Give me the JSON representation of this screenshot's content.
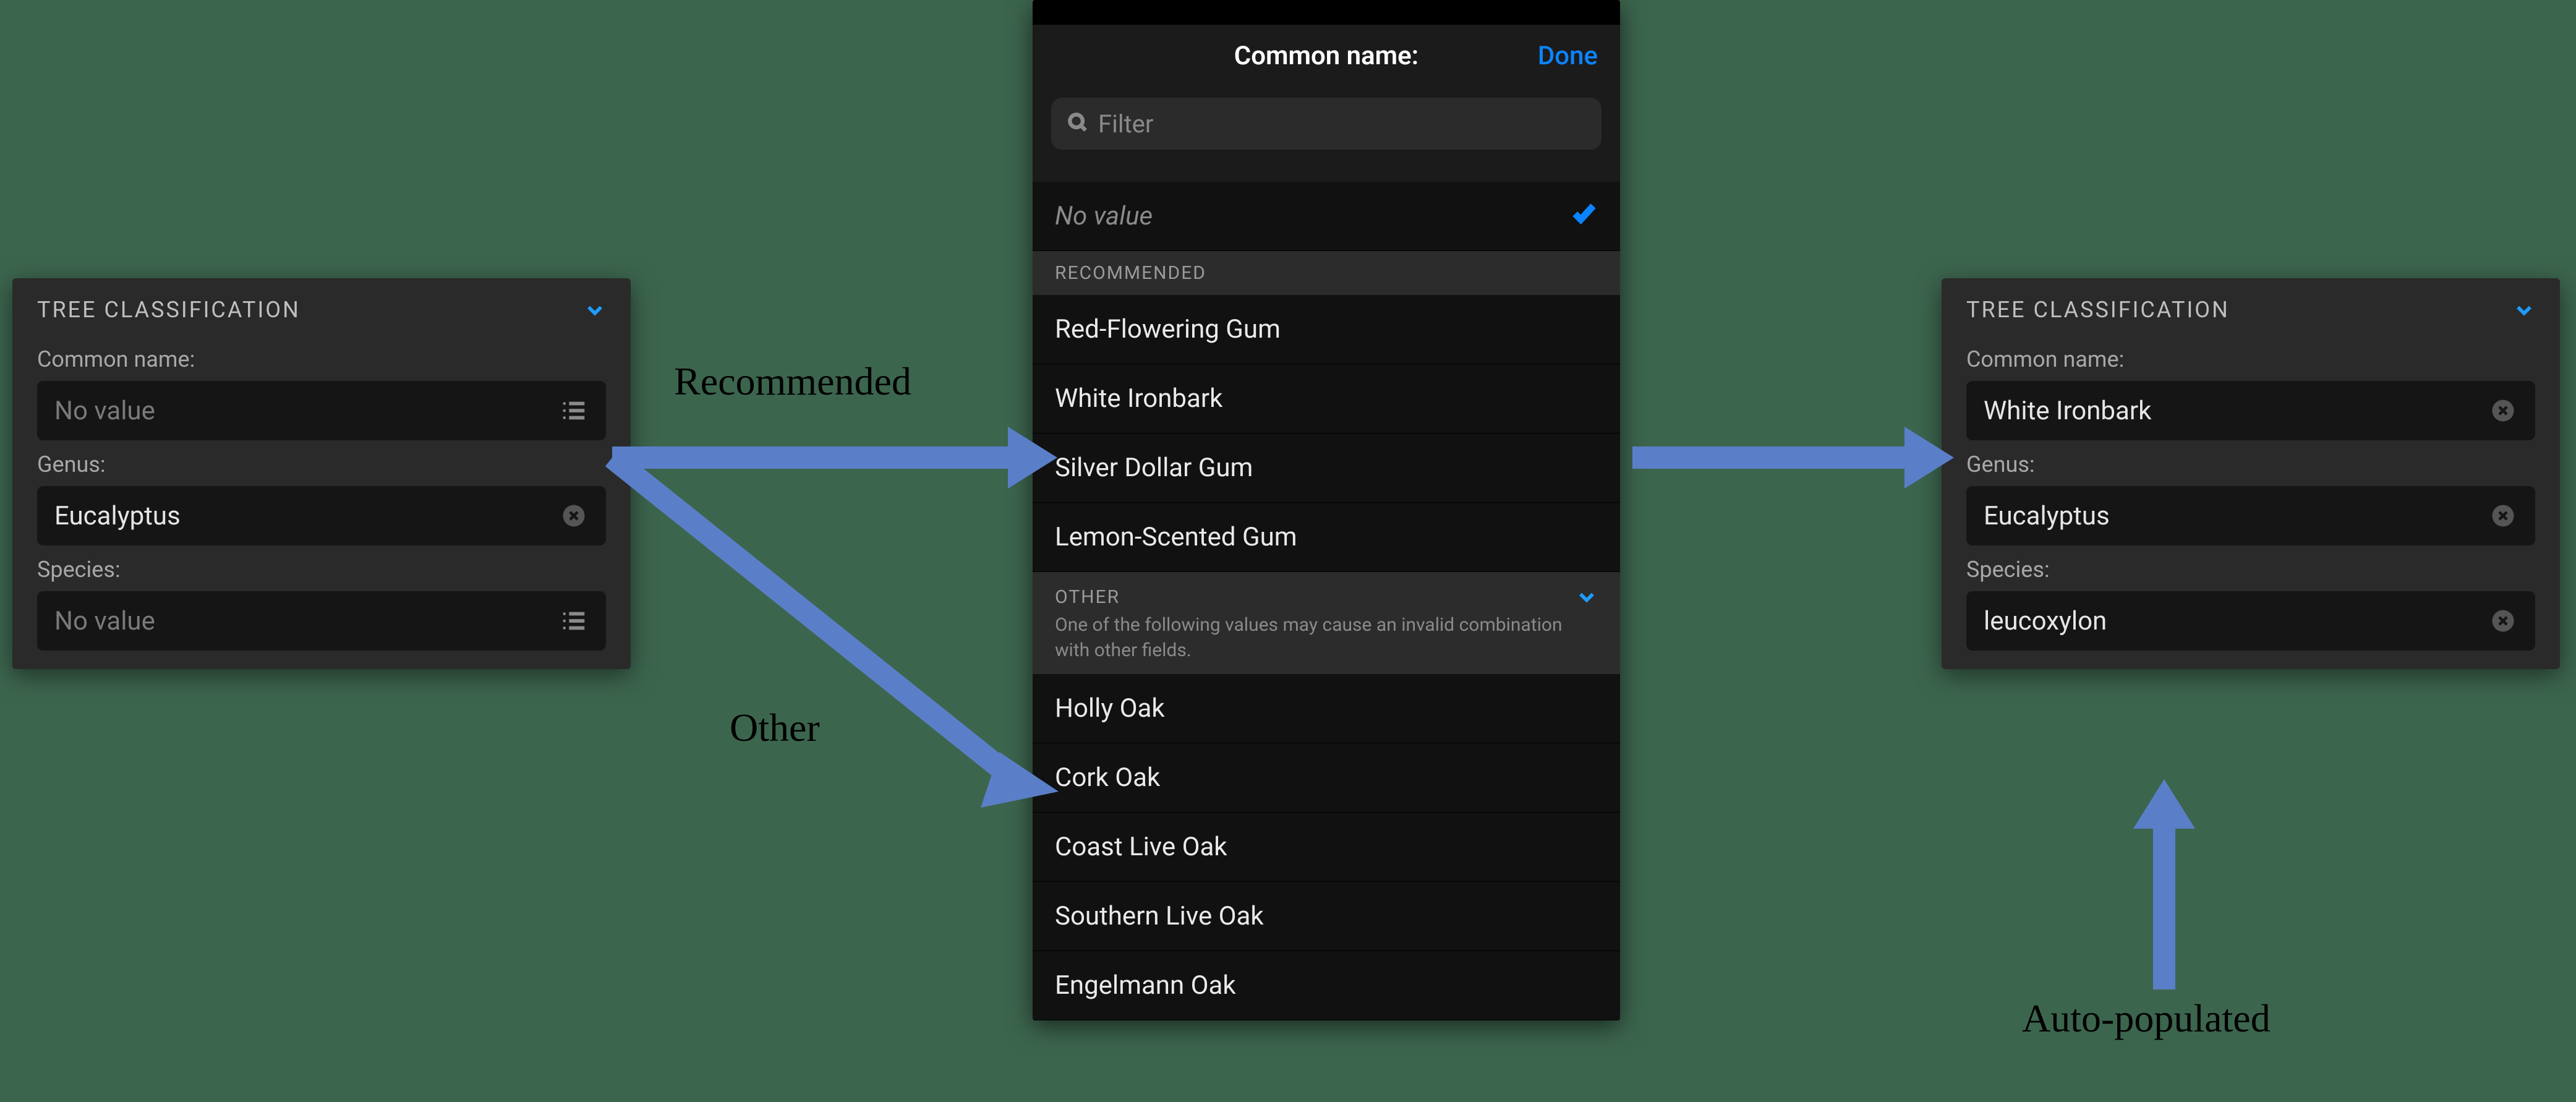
{
  "left_panel": {
    "title": "TREE CLASSIFICATION",
    "fields": {
      "common_name": {
        "label": "Common name:",
        "value": "No value",
        "is_placeholder": true,
        "trailing": "list"
      },
      "genus": {
        "label": "Genus:",
        "value": "Eucalyptus",
        "is_placeholder": false,
        "trailing": "clear"
      },
      "species": {
        "label": "Species:",
        "value": "No value",
        "is_placeholder": true,
        "trailing": "list"
      }
    }
  },
  "picker": {
    "title": "Common name:",
    "done_label": "Done",
    "filter_placeholder": "Filter",
    "no_value_label": "No value",
    "recommended_header": "RECOMMENDED",
    "recommended": [
      "Red-Flowering Gum",
      "White Ironbark",
      "Silver Dollar Gum",
      "Lemon-Scented Gum"
    ],
    "other_header": "OTHER",
    "other_subtitle": "One of the following values may cause an invalid combination with other fields.",
    "other": [
      "Holly Oak",
      "Cork Oak",
      "Coast Live Oak",
      "Southern Live Oak",
      "Engelmann Oak"
    ]
  },
  "right_panel": {
    "title": "TREE CLASSIFICATION",
    "fields": {
      "common_name": {
        "label": "Common name:",
        "value": "White Ironbark",
        "is_placeholder": false,
        "trailing": "clear"
      },
      "genus": {
        "label": "Genus:",
        "value": "Eucalyptus",
        "is_placeholder": false,
        "trailing": "clear"
      },
      "species": {
        "label": "Species:",
        "value": "leucoxylon",
        "is_placeholder": false,
        "trailing": "clear"
      }
    }
  },
  "callouts": {
    "recommended": "Recommended",
    "other": "Other",
    "auto_populated": "Auto-populated"
  },
  "colors": {
    "accent": "#0a84ff",
    "arrow": "#5a7fc8",
    "bg": "#3c654e"
  }
}
